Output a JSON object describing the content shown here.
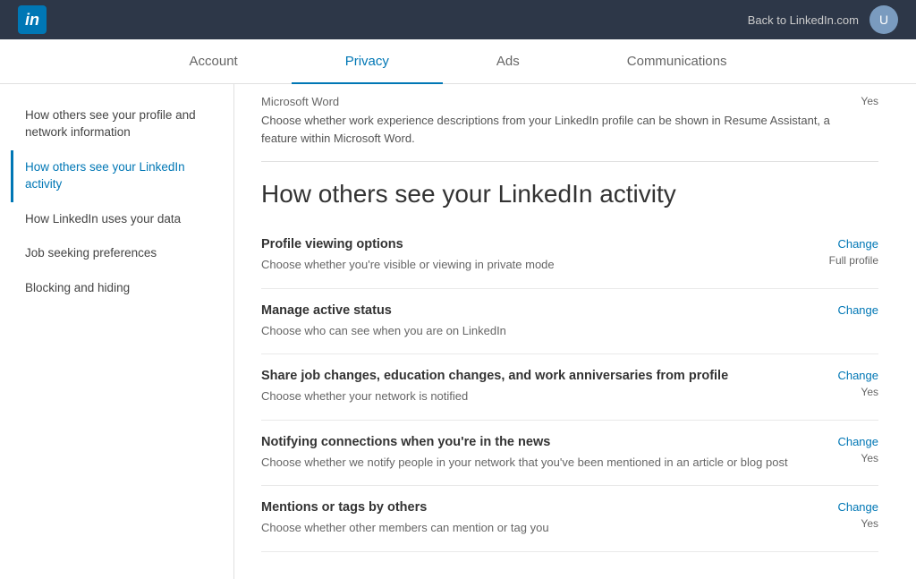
{
  "topbar": {
    "logo": "in",
    "back_link": "Back to LinkedIn.com",
    "avatar_initial": "U"
  },
  "tabs": [
    {
      "label": "Account",
      "active": false
    },
    {
      "label": "Privacy",
      "active": true
    },
    {
      "label": "Ads",
      "active": false
    },
    {
      "label": "Communications",
      "active": false
    }
  ],
  "sidebar": {
    "items": [
      {
        "label": "How others see your profile and network information",
        "active": false
      },
      {
        "label": "How others see your LinkedIn activity",
        "active": true
      },
      {
        "label": "How LinkedIn uses your data",
        "active": false
      },
      {
        "label": "Job seeking preferences",
        "active": false
      },
      {
        "label": "Blocking and hiding",
        "active": false
      }
    ]
  },
  "partial_section": {
    "title": "Microsoft Word",
    "description": "Choose whether work experience descriptions from your LinkedIn profile can be shown in Resume Assistant, a feature within Microsoft Word.",
    "status": "Yes"
  },
  "main": {
    "heading": "How others see your LinkedIn activity",
    "settings": [
      {
        "title": "Profile viewing options",
        "description": "Choose whether you're visible or viewing in private mode",
        "change_label": "Change",
        "value": "Full profile"
      },
      {
        "title": "Manage active status",
        "description": "Choose who can see when you are on LinkedIn",
        "change_label": "Change",
        "value": ""
      },
      {
        "title": "Share job changes, education changes, and work anniversaries from profile",
        "description": "Choose whether your network is notified",
        "change_label": "Change",
        "value": "Yes"
      },
      {
        "title": "Notifying connections when you're in the news",
        "description": "Choose whether we notify people in your network that you've been mentioned in an article or blog post",
        "change_label": "Change",
        "value": "Yes"
      },
      {
        "title": "Mentions or tags by others",
        "description": "Choose whether other members can mention or tag you",
        "change_label": "Change",
        "value": "Yes"
      }
    ]
  }
}
